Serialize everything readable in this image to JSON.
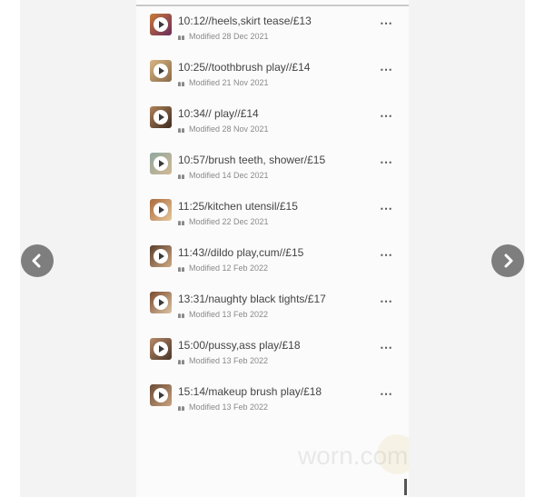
{
  "videos": [
    {
      "title": "10:12//heels,skirt tease/£13",
      "modified": "Modified 28 Dec 2021",
      "colors": [
        "#c77b3a",
        "#6b2a5a"
      ]
    },
    {
      "title": "10:25//toothbrush play//£14",
      "modified": "Modified 21 Nov 2021",
      "colors": [
        "#d7b584",
        "#8a6a47"
      ]
    },
    {
      "title": "10:34// play//£14",
      "modified": "Modified 28 Nov 2021",
      "colors": [
        "#b0835a",
        "#3e2a1f"
      ]
    },
    {
      "title": "10:57/brush teeth, shower/£15",
      "modified": "Modified 14 Dec 2021",
      "colors": [
        "#8fa8a0",
        "#d3b894"
      ]
    },
    {
      "title": "11:25/kitchen utensil/£15",
      "modified": "Modified 22 Dec 2021",
      "colors": [
        "#a96a3c",
        "#e7c79c"
      ]
    },
    {
      "title": "11:43//dildo play,cum//£15",
      "modified": "Modified 12 Feb 2022",
      "colors": [
        "#5a3e2c",
        "#cfa983"
      ]
    },
    {
      "title": "13:31/naughty black tights/£17",
      "modified": "Modified 13 Feb 2022",
      "colors": [
        "#7b4a2c",
        "#dcc4a6"
      ]
    },
    {
      "title": "15:00/pussy,ass play/£18",
      "modified": "Modified 13 Feb 2022",
      "colors": [
        "#b88b68",
        "#4a3528"
      ]
    },
    {
      "title": "15:14/makeup brush play/£18",
      "modified": "Modified 13 Feb 2022",
      "colors": [
        "#6b4a35",
        "#c9a27f"
      ]
    }
  ],
  "more_icon": "⋯",
  "nav": {
    "prev_icon": "chevron-left-icon",
    "next_icon": "chevron-right-icon"
  },
  "watermark": "worn.com"
}
